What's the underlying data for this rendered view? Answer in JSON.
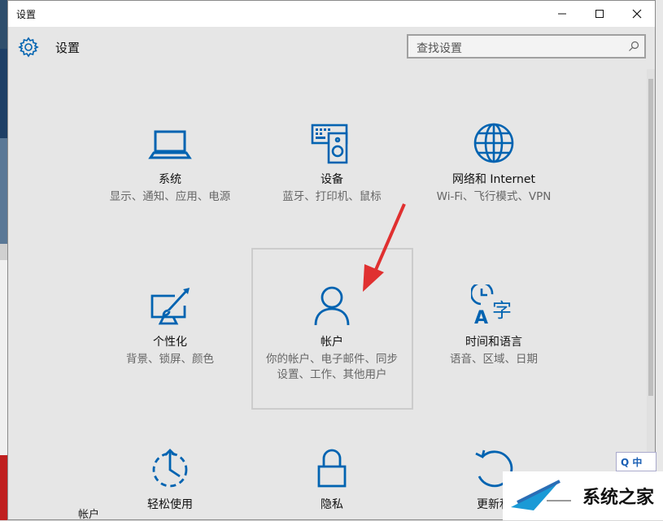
{
  "window": {
    "title": "设置"
  },
  "header": {
    "title": "设置"
  },
  "search": {
    "placeholder": "查找设置"
  },
  "tiles": [
    {
      "name": "系统",
      "desc": "显示、通知、应用、电源",
      "icon": "laptop-icon"
    },
    {
      "name": "设备",
      "desc": "蓝牙、打印机、鼠标",
      "icon": "devices-icon"
    },
    {
      "name": "网络和 Internet",
      "desc": "Wi-Fi、飞行模式、VPN",
      "icon": "globe-icon"
    },
    {
      "name": "个性化",
      "desc": "背景、锁屏、颜色",
      "icon": "personalization-icon"
    },
    {
      "name": "帐户",
      "desc": "你的帐户、电子邮件、同步设置、工作、其他用户",
      "icon": "person-icon"
    },
    {
      "name": "时间和语言",
      "desc": "语音、区域、日期",
      "icon": "time-language-icon"
    },
    {
      "name": "轻松使用",
      "desc": "",
      "icon": "ease-of-access-icon"
    },
    {
      "name": "隐私",
      "desc": "",
      "icon": "lock-icon"
    },
    {
      "name": "更新和",
      "desc": "",
      "icon": "update-icon"
    }
  ],
  "ime": {
    "label": "中"
  },
  "watermark": {
    "text": "系统之家"
  },
  "background": {
    "taskbar_item": "帐户"
  },
  "colors": {
    "accent": "#0063b1",
    "arrow": "#e03030"
  }
}
